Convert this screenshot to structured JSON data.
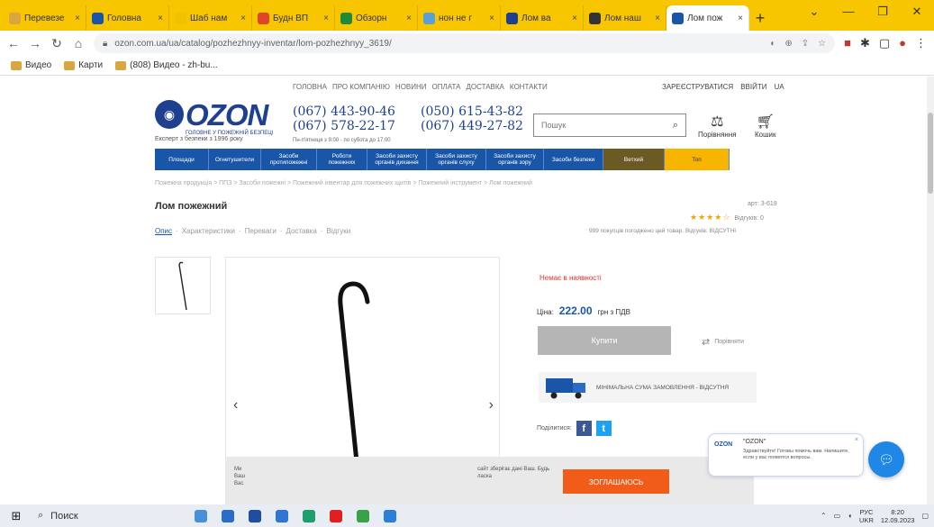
{
  "browser": {
    "tabs": [
      {
        "label": "Перевезе",
        "color": "#d9a640",
        "active": false
      },
      {
        "label": "Головна",
        "color": "#1a56a8",
        "active": false
      },
      {
        "label": "Шаб нам",
        "color": "#f2c200",
        "active": false
      },
      {
        "label": "Будн ВП",
        "color": "#e0452b",
        "active": false
      },
      {
        "label": "Обзорн",
        "color": "#1f8a3a",
        "active": false
      },
      {
        "label": "нон не г",
        "color": "#5aa0d8",
        "active": false
      },
      {
        "label": "Лом ва",
        "color": "#1f3f8f",
        "active": false
      },
      {
        "label": "Лом наш",
        "color": "#333333",
        "active": false
      },
      {
        "label": "Лом пож",
        "color": "#1a56a8",
        "active": true
      }
    ],
    "new_tab": "+",
    "address": "ozon.com.ua/ua/catalog/pozhezhnyy-inventar/lom-pozhezhnyy_3619/",
    "bookmarks": [
      {
        "label": "Видео"
      },
      {
        "label": "Карти"
      },
      {
        "label": "(808) Видео - zh-bu..."
      }
    ]
  },
  "site": {
    "top_links": [
      "ГОЛОВНА",
      "ПРО КОМПАНІЮ",
      "НОВИНИ",
      "ОПЛАТА",
      "ДОСТАВКА",
      "КОНТАКТИ"
    ],
    "top_right": [
      "ЗАРЕЄСТРУВАТИСЯ",
      "ВВІЙТИ",
      "UA"
    ],
    "logo_word": "OZON",
    "logo_sub": "ГОЛОВНЕ У ПОЖЕЖНІЙ БЕЗПЕЦІ",
    "logo_tag": "Експерт з безпеки з 1996 року",
    "phones_left": [
      "(067) 443-90-46",
      "(067) 578-22-17"
    ],
    "phones_note": "Пн-п'ятниця з 9:00 - по субота до 17:00",
    "phones_right": [
      "(050) 615-43-82",
      "(067) 449-27-82"
    ],
    "search_placeholder": "Пошук",
    "compare_label": "Порівняння",
    "cart_label": "Кошик",
    "nav": [
      {
        "label": "Площади",
        "style": "blue"
      },
      {
        "label": "Огнетушители",
        "style": "blue"
      },
      {
        "label": "Засоби протипожежні",
        "style": "blue"
      },
      {
        "label": "Роботи пожежних",
        "style": "blue"
      },
      {
        "label": "Засоби захисту органів дихання",
        "style": "blue"
      },
      {
        "label": "Засоби захисту органів слуху",
        "style": "blue"
      },
      {
        "label": "Засоби захисту органів зору",
        "style": "blue"
      },
      {
        "label": "Засоби безпеки",
        "style": "blue"
      },
      {
        "label": "Ветхий",
        "style": "dark"
      },
      {
        "label": "Топ",
        "style": "orange"
      }
    ],
    "breadcrumb": "Пожежна продукція > ППЗ > Засоби пожежні > Пожежний інвентар для пожежних щитів > Пожежний інструмент > Лом пожежний"
  },
  "product": {
    "title": "Лом пожежний",
    "article": "арт: 3-619",
    "rating": 4,
    "reviews": "Відгуків: 0",
    "tabs": [
      "Опис",
      "Характеристики",
      "Переваги",
      "Доставка",
      "Відгуки"
    ],
    "buyers_note": "999 покупців погоджено цей товар. Відгуків: ВІДСУТНІ",
    "availability": "Немає в наявності",
    "price_label": "Ціна:",
    "price_value": "222.00",
    "price_unit": "грн з ПДВ",
    "buy_label": "Купити",
    "compare_label": "Порівняти",
    "delivery_text": "МІНІМАЛЬНА СУМА ЗАМОВЛЕННЯ - ВІДСУТНЯ",
    "share_label": "Поділитися:"
  },
  "cookie": {
    "text_left": "Ми Ваш Вас",
    "text_right": "сайт зберігає дані Ваш. Будь ласка",
    "button_label": "ЗОГЛАШАЮСЬ"
  },
  "chat": {
    "logo": "OZON",
    "name": "\"OZON\"",
    "message": "Здравствуйте! Готовы помочь вам. Напишите, если у вас появятся вопросы."
  },
  "taskbar": {
    "search_label": "Поиск",
    "lang": "РУС",
    "lang2": "UKR",
    "time": "8:20",
    "date": "12.09.2023",
    "apps": [
      "#4a90d9",
      "#2b6cc4",
      "#1f4ea1",
      "#2f76d2",
      "#1f9d6c",
      "#e02020",
      "#3aa04a",
      "#2d7fd3"
    ]
  },
  "colors": {
    "brand_blue": "#1a56a8",
    "logo_blue": "#1f3f8f",
    "cta_orange": "#f25c19",
    "tab_bar": "#f7c600"
  }
}
